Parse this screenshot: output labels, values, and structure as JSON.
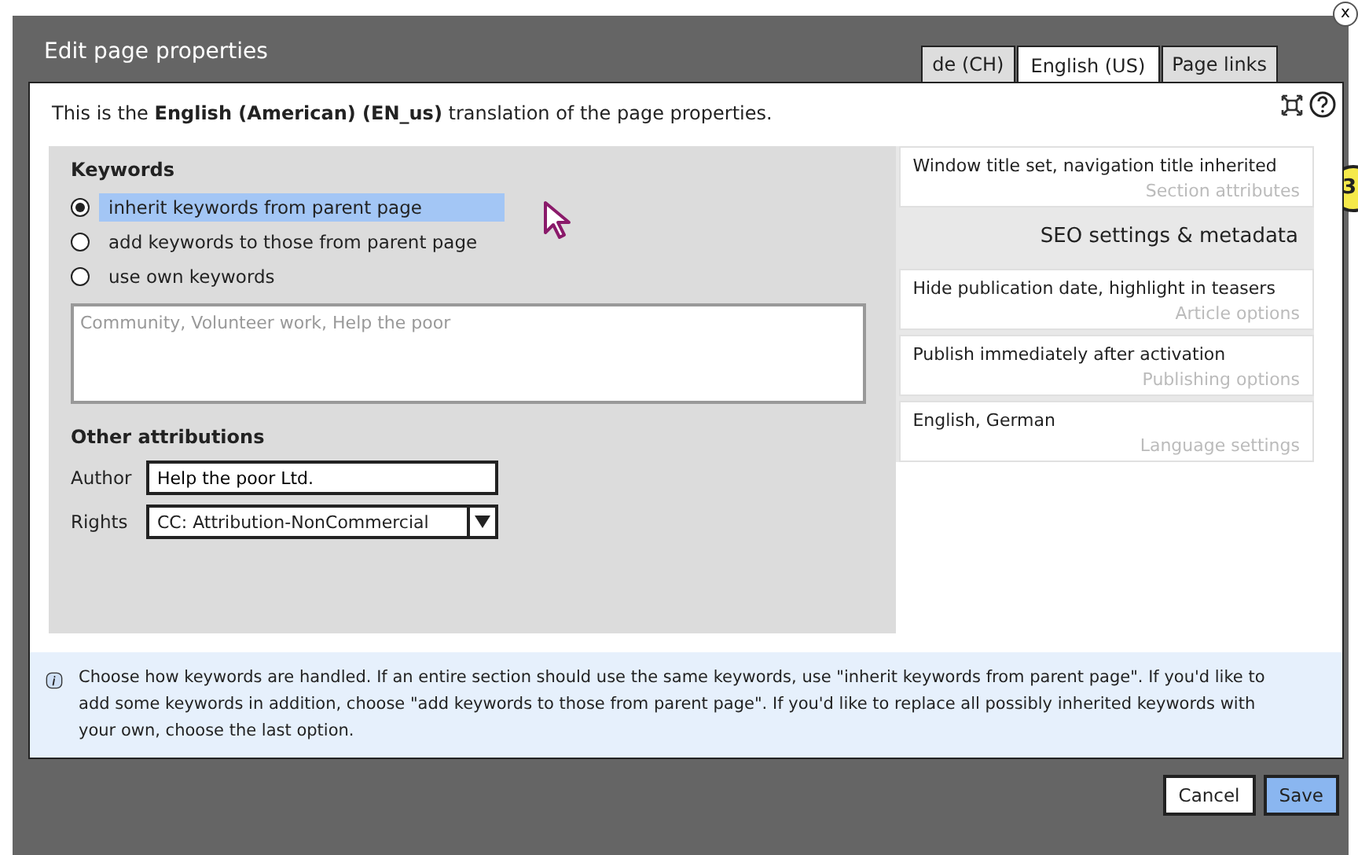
{
  "window": {
    "title": "Edit page properties",
    "close": "x"
  },
  "tabs": [
    {
      "label": "de (CH)",
      "selected": false
    },
    {
      "label": "English (US)",
      "selected": true
    },
    {
      "label": "Page links",
      "selected": false
    }
  ],
  "intro": "This is the **English (American) (EN_us)** translation of the page properties.",
  "keywords": {
    "heading": "Keywords",
    "options": [
      {
        "label": "inherit keywords from parent page",
        "selected": true
      },
      {
        "label": "add keywords to those from parent page",
        "selected": false
      },
      {
        "label": "use own keywords",
        "selected": false
      }
    ],
    "placeholder": "Community, Volunteer work, Help the poor"
  },
  "attributions": {
    "heading": "Other attributions",
    "author": {
      "label": "Author",
      "value": "Help the poor Ltd."
    },
    "rights": {
      "label": "Rights",
      "value": "CC: Attribution-NonCommercial"
    }
  },
  "sections": [
    {
      "kind": "card",
      "summary": "Window title set, navigation title inherited",
      "title": "Section attributes"
    },
    {
      "kind": "header",
      "title": "SEO settings & metadata"
    },
    {
      "kind": "card",
      "summary": "Hide publication date, highlight in teasers",
      "title": "Article options"
    },
    {
      "kind": "card",
      "summary": "Publish immediately after activation",
      "title": "Publishing options"
    },
    {
      "kind": "card",
      "summary": "English, German",
      "title": "Language settings"
    }
  ],
  "info": "Choose how keywords are handled. If an entire section should use the same keywords, use \"inherit keywords from parent page\". If you'd like to add some keywords in addition, choose \"add keywords to those from parent page\". If you'd like to replace all possibly inherited keywords with your own, choose the last option.",
  "buttons": [
    {
      "label": "Cancel",
      "primary": false
    },
    {
      "label": "Save",
      "primary": true
    }
  ],
  "callout": "3"
}
